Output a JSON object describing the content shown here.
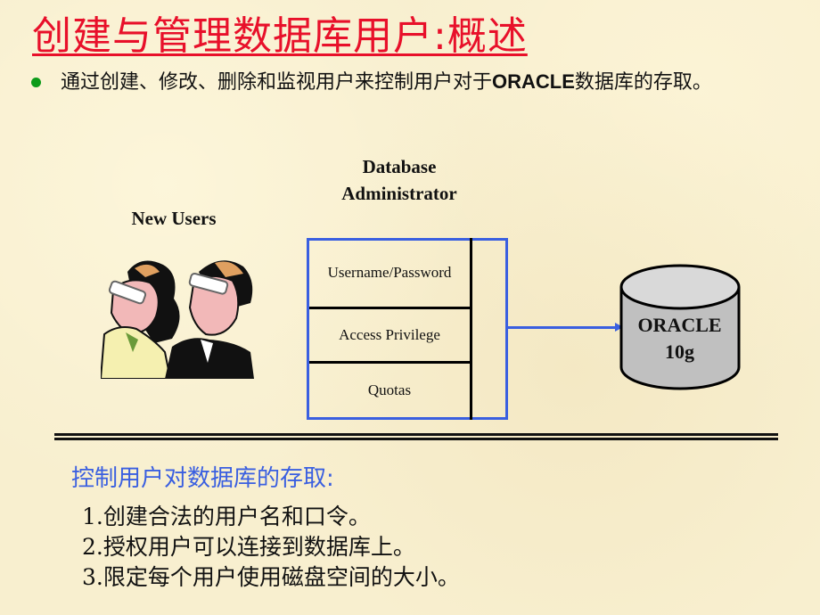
{
  "slide": {
    "title": "创建与管理数据库用户:概述",
    "bullet": {
      "prefix": "通过创建、修改、删除和监视用户来控制用户对于",
      "bold": "ORACLE",
      "suffix": "数据库的存取。"
    },
    "colors": {
      "title": "#e8102a",
      "bullet_dot": "#0d9b1a",
      "accent_blue": "#3a5fe0",
      "background": "#f8efcf"
    }
  },
  "diagram": {
    "users_label": "New Users",
    "users_image": "two-people-with-glasses-illustration",
    "dba_label_line1": "Database",
    "dba_label_line2": "Administrator",
    "admin_items": [
      "Username/Password",
      "Access Privilege",
      "Quotas"
    ],
    "database": {
      "line1": "ORACLE",
      "line2": "10g",
      "icon": "database-cylinder-icon"
    }
  },
  "summary": {
    "heading": "控制用户对数据库的存取:",
    "items": [
      "1.创建合法的用户名和口令。",
      "2.授权用户可以连接到数据库上。",
      "3.限定每个用户使用磁盘空间的大小。"
    ]
  }
}
